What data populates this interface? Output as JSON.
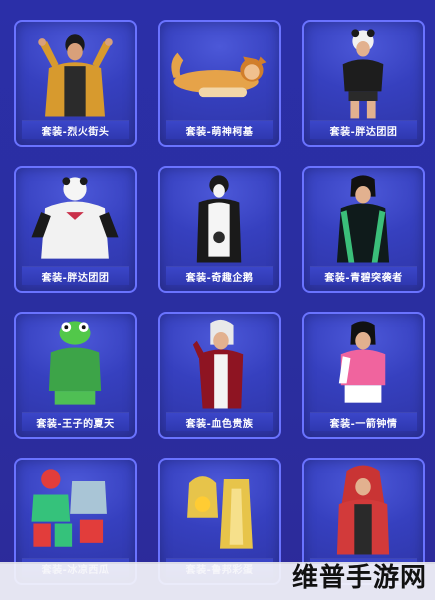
{
  "cards": [
    {
      "label": "套装-烈火街头",
      "accent": "#e0a431"
    },
    {
      "label": "套装-萌神柯基",
      "accent": "#f0a63e"
    },
    {
      "label": "套装-胖达团团",
      "accent": "#e8e8e8"
    },
    {
      "label": "套装-胖达团团",
      "accent": "#f2f2f2"
    },
    {
      "label": "套装-奇趣企鹅",
      "accent": "#ffffff"
    },
    {
      "label": "套装-青碧突袭者",
      "accent": "#3bbf7a"
    },
    {
      "label": "套装-王子的夏天",
      "accent": "#48c24c"
    },
    {
      "label": "套装-血色贵族",
      "accent": "#b01a2a"
    },
    {
      "label": "套装-一箭钟情",
      "accent": "#f06aa4"
    },
    {
      "label": "套装-冰凉西瓜",
      "accent": "#e23d3b"
    },
    {
      "label": "套装-鲁邦彩蛋",
      "accent": "#e7c44a"
    },
    {
      "label": "",
      "accent": "#d23a3a"
    }
  ],
  "watermark": {
    "text": "维普手游网"
  }
}
